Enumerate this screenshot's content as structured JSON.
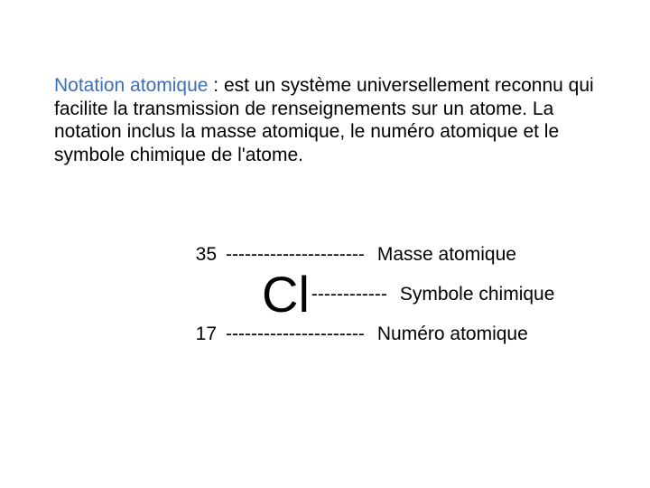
{
  "paragraph": {
    "term": "Notation atomique",
    "rest": " : est un système universellement reconnu qui facilite la transmission de renseignements sur un atome. La notation inclus la masse atomique, le numéro atomique et le symbole chimique de l'atome."
  },
  "notation": {
    "mass_number": "35",
    "mass_dashes": "----------------------",
    "mass_label": "Masse atomique",
    "symbol": "Cl",
    "symbol_dashes": "------------",
    "symbol_label": "Symbole chimique",
    "atomic_number": "17",
    "atomic_dashes": "----------------------",
    "atomic_label": "Numéro atomique"
  }
}
